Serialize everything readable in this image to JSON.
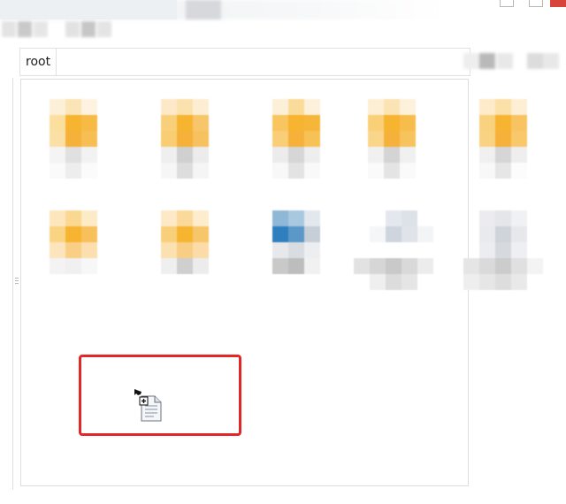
{
  "address_bar": {
    "breadcrumb_root": "root"
  },
  "colors": {
    "folder_yellow": "#f6b431",
    "folder_light": "#fde8bd",
    "doc_blue": "#2f7fbf",
    "doc_gray": "#c9ced6",
    "highlight_red": "#e32727",
    "close_button_red": "#d7443a"
  },
  "file_items": [
    {
      "icon": "folder-icon"
    },
    {
      "icon": "folder-icon"
    },
    {
      "icon": "folder-icon"
    },
    {
      "icon": "folder-icon"
    },
    {
      "icon": "folder-icon"
    },
    {
      "icon": "folder-icon"
    },
    {
      "icon": "folder-icon"
    },
    {
      "icon": "blue-document-icon"
    },
    {
      "icon": "document-icon"
    },
    {
      "icon": "document-icon"
    }
  ],
  "drag_cursor": {
    "icon": "copy-document-cursor-icon",
    "action": "copy"
  }
}
